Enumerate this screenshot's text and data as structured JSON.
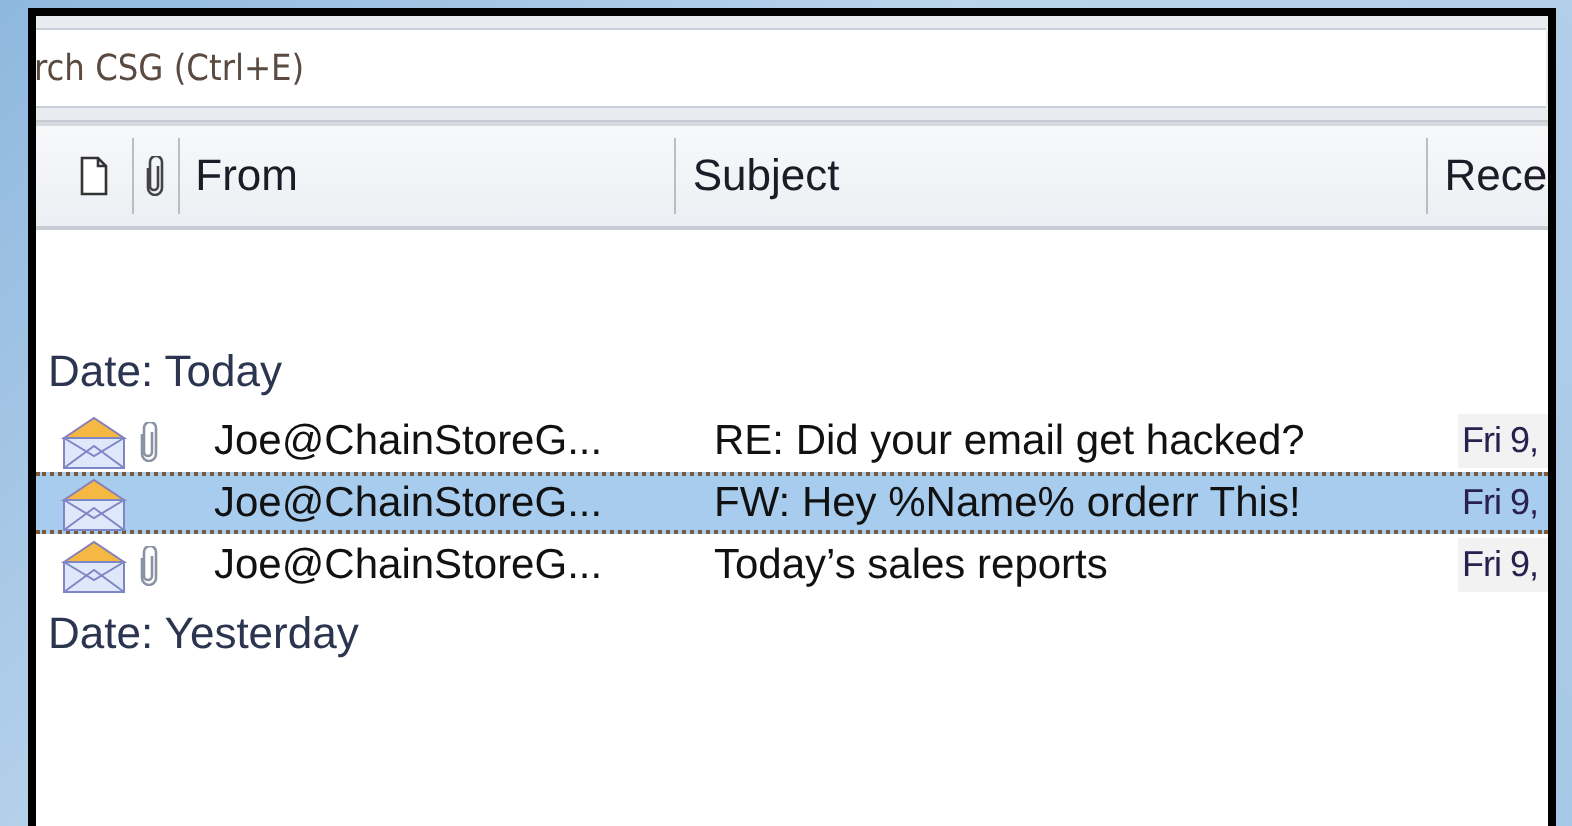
{
  "search": {
    "placeholder": "rch CSG (Ctrl+E)"
  },
  "columns": [
    {
      "kind": "document"
    },
    {
      "kind": "attachment"
    },
    {
      "kind": "text",
      "label": "From"
    },
    {
      "kind": "text",
      "label": "Subject"
    },
    {
      "kind": "text",
      "label": "Rece"
    }
  ],
  "groups": [
    {
      "label": "Date: Today",
      "messages": [
        {
          "from": "Joe@ChainStoreG...",
          "subject": "RE: Did your email get hacked?",
          "received": "Fri 9,",
          "attachment": true,
          "selected": false
        },
        {
          "from": "Joe@ChainStoreG...",
          "subject": "FW: Hey %Name% orderr This!",
          "received": "Fri 9,",
          "attachment": false,
          "selected": true
        },
        {
          "from": "Joe@ChainStoreG...",
          "subject": "Today’s sales reports",
          "received": "Fri 9,",
          "attachment": true,
          "selected": false
        }
      ]
    },
    {
      "label": "Date: Yesterday"
    }
  ]
}
